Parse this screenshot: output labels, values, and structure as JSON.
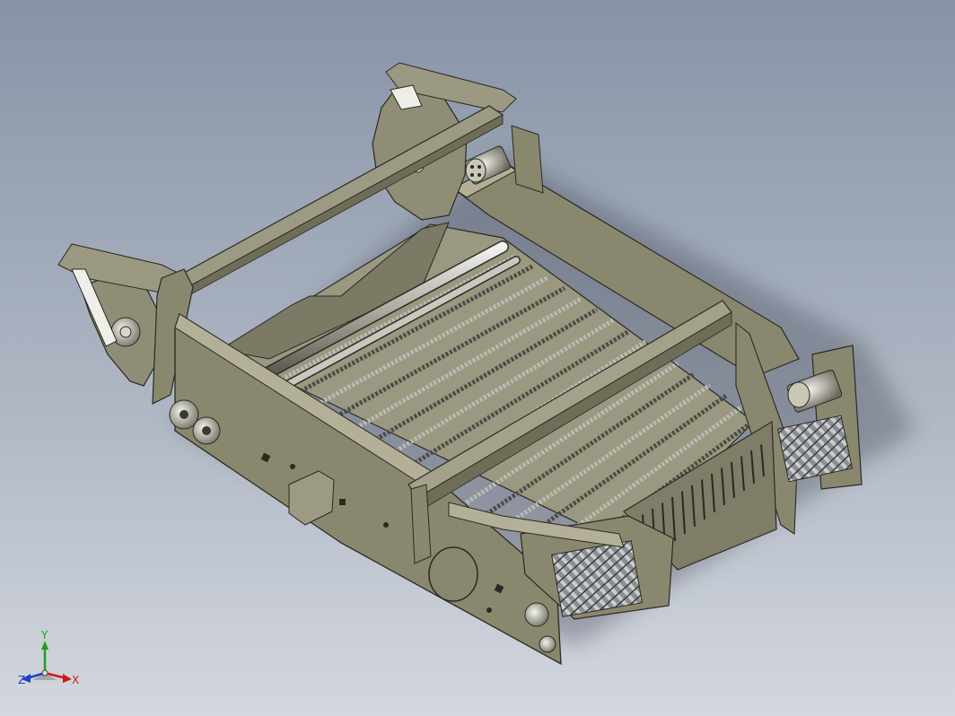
{
  "view": {
    "background_top": "#8793a6",
    "background_bottom": "#d3d7de",
    "model_color": "#8a876f",
    "model_edge_color": "#2b2a22"
  },
  "triad": {
    "x_label": "X",
    "y_label": "Y",
    "z_label": "Z",
    "x_color": "#d01818",
    "y_color": "#1aa31a",
    "z_color": "#1d3fd0"
  }
}
